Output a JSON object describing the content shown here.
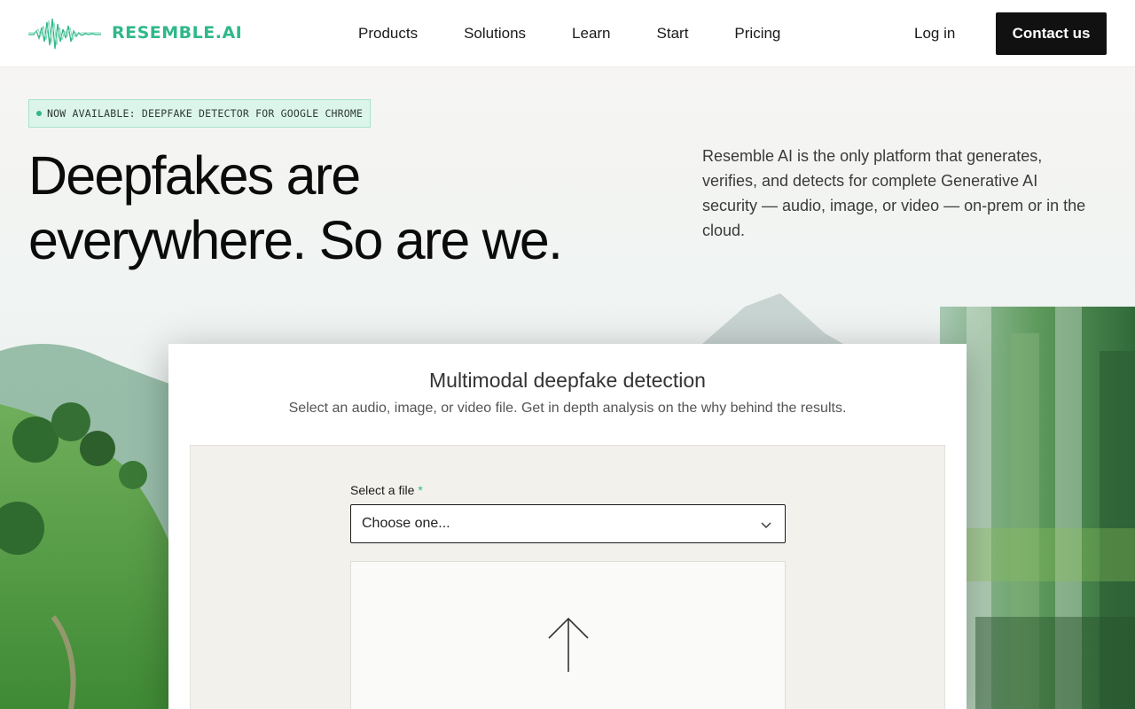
{
  "header": {
    "logo_text": "RESEMBLE.AI",
    "nav": [
      "Products",
      "Solutions",
      "Learn",
      "Start",
      "Pricing"
    ],
    "login_label": "Log in",
    "contact_label": "Contact us"
  },
  "hero": {
    "badge_text": "NOW AVAILABLE: DEEPFAKE DETECTOR FOR GOOGLE CHROME",
    "title_line1": "Deepfakes are",
    "title_line2": "everywhere. So are we.",
    "description": "Resemble AI is the only platform that generates, verifies, and detects for complete Generative AI security — audio, image, or video — on-prem or in the cloud."
  },
  "detector": {
    "title": "Multimodal deepfake detection",
    "subtitle": "Select an audio, image, or video file. Get in depth analysis on the why behind the results.",
    "field_label": "Select a file",
    "required_mark": "*",
    "select_value": "Choose one..."
  },
  "icons": {
    "logo": "waveform-icon",
    "select": "chevron-down-icon",
    "upload": "arrow-up-icon"
  },
  "colors": {
    "brand": "#2fb88a",
    "button_bg": "#111111",
    "badge_bg": "#dcf5ea"
  }
}
